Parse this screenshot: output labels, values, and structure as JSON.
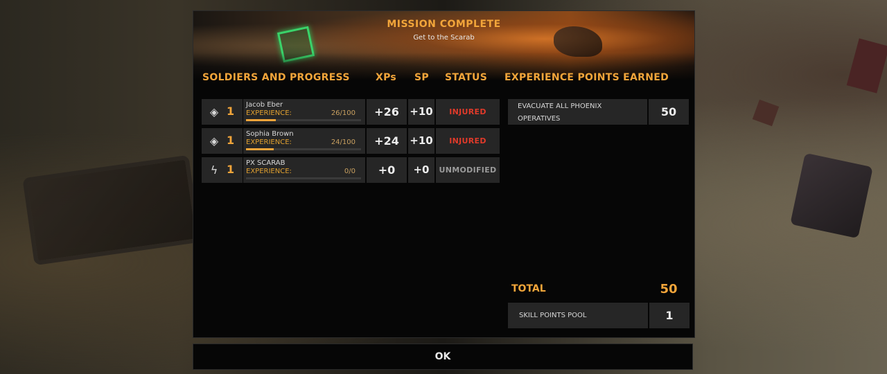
{
  "mission": {
    "title": "MISSION COMPLETE",
    "subtitle": "Get to the Scarab"
  },
  "headers": {
    "soldiers": "SOLDIERS AND PROGRESS",
    "xps": "XPs",
    "sp": "SP",
    "status": "STATUS",
    "xp_earned": "EXPERIENCE POINTS EARNED"
  },
  "soldiers": [
    {
      "rank": "1",
      "icon": "soldier-rank-icon",
      "name": "Jacob Eber",
      "exp_label": "EXPERIENCE:",
      "exp_value": "26/100",
      "exp_progress": 0.26,
      "xp": "+26",
      "sp": "+10",
      "status": "INJURED"
    },
    {
      "rank": "1",
      "icon": "soldier-rank-icon",
      "name": "Sophia Brown",
      "exp_label": "EXPERIENCE:",
      "exp_value": "24/100",
      "exp_progress": 0.24,
      "xp": "+24",
      "sp": "+10",
      "status": "INJURED"
    },
    {
      "rank": "1",
      "icon": "vehicle-rank-icon",
      "name": "PX SCARAB",
      "exp_label": "EXPERIENCE:",
      "exp_value": "0/0",
      "exp_progress": 0,
      "xp": "+0",
      "sp": "+0",
      "status": "UNMODIFIED"
    }
  ],
  "xp_earned": [
    {
      "name_line1": "EVACUATE ALL PHOENIX",
      "name_line2": "OPERATIVES",
      "value": "50"
    }
  ],
  "total": {
    "label": "TOTAL",
    "value": "50"
  },
  "skill_pool": {
    "label": "SKILL POINTS POOL",
    "value": "1"
  },
  "ok_label": "OK",
  "colors": {
    "accent": "#f2a53a",
    "injured": "#e03a2a",
    "unmodified": "#9a9a9a",
    "cell": "#262626",
    "panel": "#060606"
  }
}
